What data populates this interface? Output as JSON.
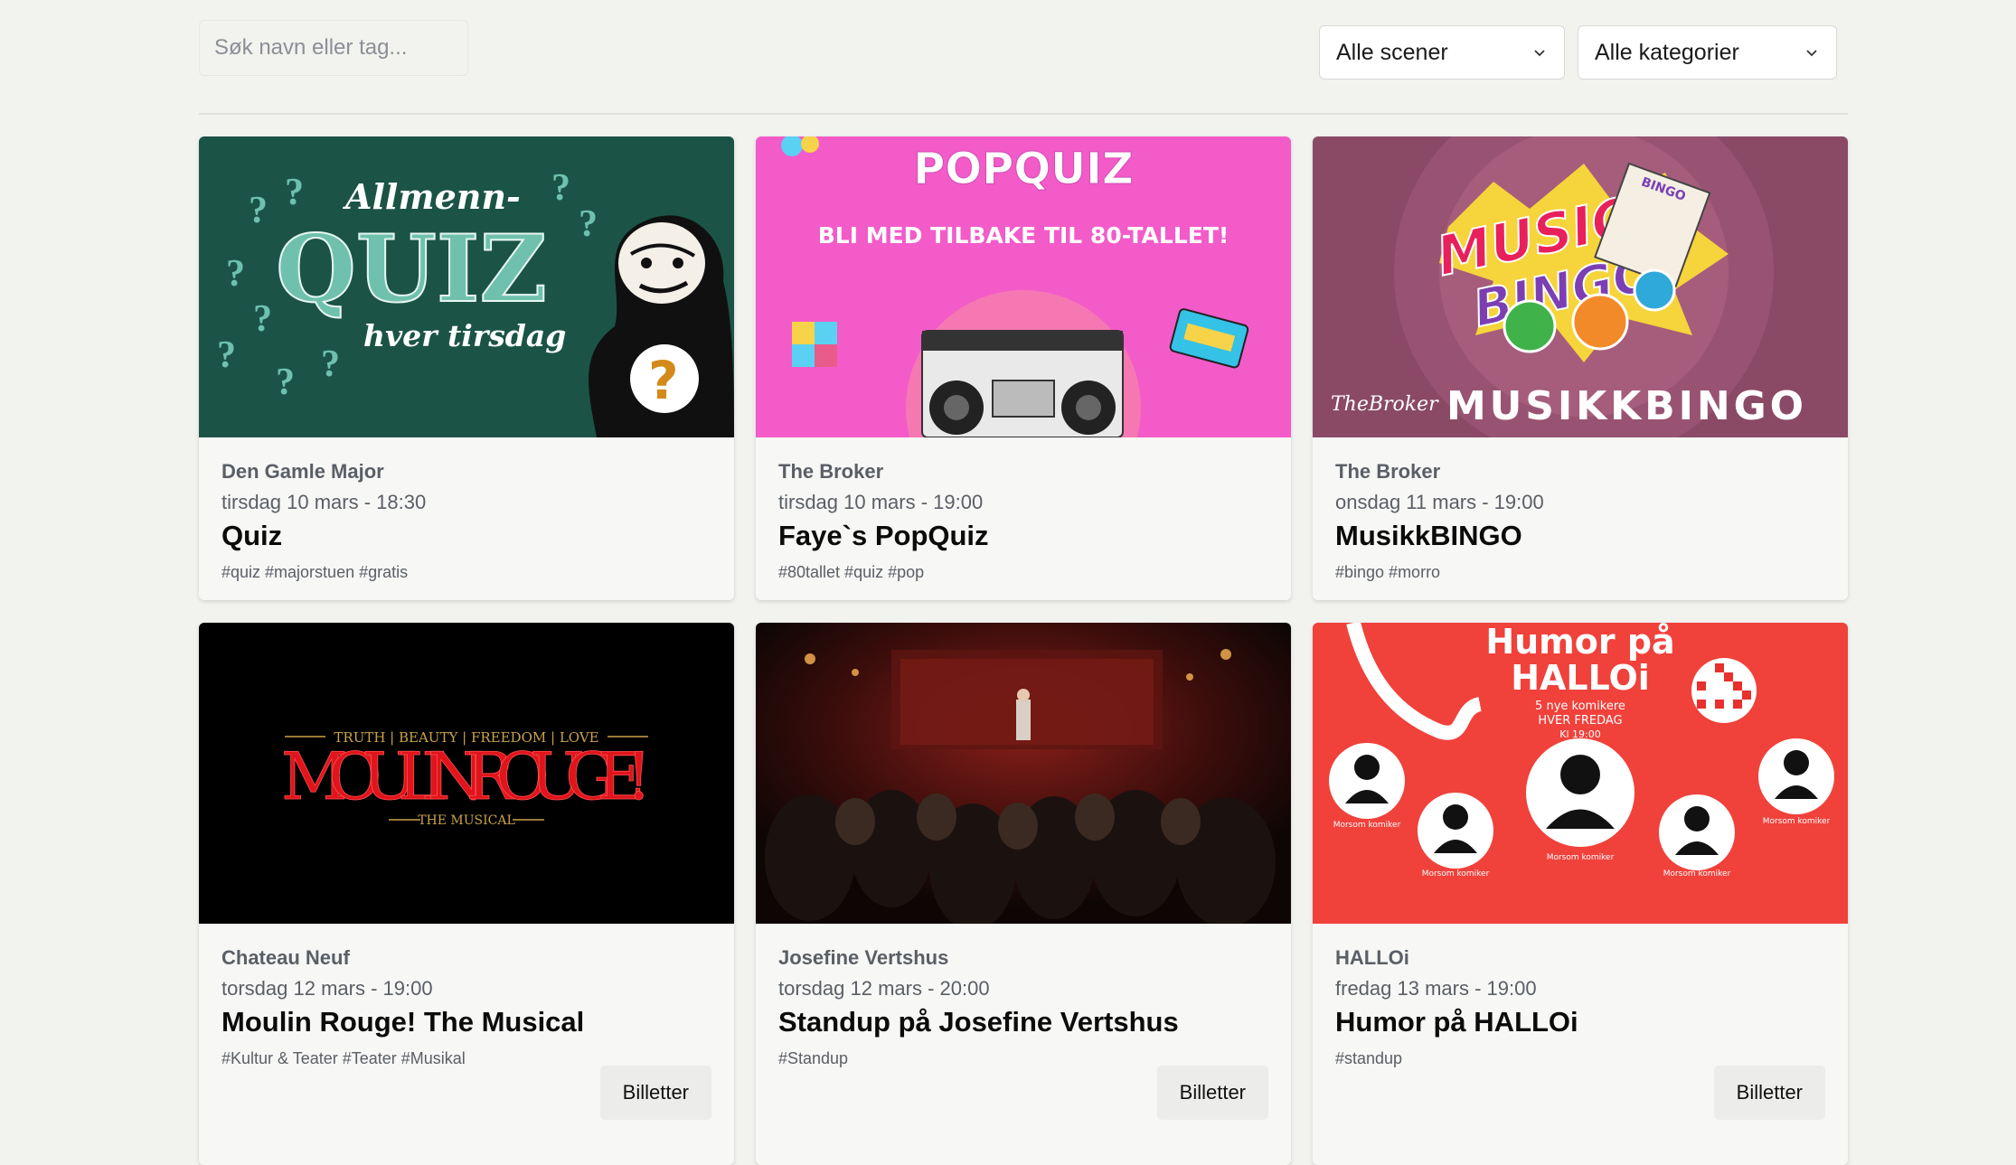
{
  "filters": {
    "search_placeholder": "Søk navn eller tag...",
    "scene_select": "Alle scener",
    "category_select": "Alle kategorier"
  },
  "events": [
    {
      "venue": "Den Gamle Major",
      "date": "tirsdag 10 mars - 18:30",
      "title": "Quiz",
      "tags": "#quiz #majorstuen #gratis",
      "image": {
        "line1": "Allmenn-",
        "line2": "QUIZ",
        "line3": "hver tirsdag",
        "bg": "#1f5c4e"
      }
    },
    {
      "venue": "The Broker",
      "date": "tirsdag 10 mars - 19:00",
      "title": "Faye`s PopQuiz",
      "tags": "#80tallet #quiz #pop",
      "image": {
        "line1": "POPQUIZ",
        "line2": "BLI MED TILBAKE TIL 80-TALLET!",
        "bg": "#f35bc9"
      }
    },
    {
      "venue": "The Broker",
      "date": "onsdag 11 mars - 19:00",
      "title": "MusikkBINGO",
      "tags": "#bingo #morro",
      "image": {
        "line1": "MUSIC",
        "line2": "BINGO!",
        "line3": "MUSIKKBINGO",
        "brand": "TheBroker",
        "badge": "BINGO",
        "bg": "#8a4a66"
      }
    },
    {
      "venue": "Chateau Neuf",
      "date": "torsdag 12 mars - 19:00",
      "title": "Moulin Rouge! The Musical",
      "tags": "#Kultur & Teater #Teater #Musikal",
      "tickets": "Billetter",
      "image": {
        "line1": "TRUTH | BEAUTY | FREEDOM | LOVE",
        "line2": "MOULIN ROUGE!",
        "line3": "THE MUSICAL",
        "bg": "#000000"
      }
    },
    {
      "venue": "Josefine Vertshus",
      "date": "torsdag 12 mars - 20:00",
      "title": "Standup på Josefine Vertshus",
      "tags": "#Standup",
      "tickets": "Billetter",
      "image": {
        "bg": "#1a0f0c"
      }
    },
    {
      "venue": "HALLOi",
      "date": "fredag 13 mars - 19:00",
      "title": "Humor på HALLOi",
      "tags": "#standup",
      "tickets": "Billetter",
      "image": {
        "line1": "Humor på",
        "line2": "HALLOi",
        "line3": "5 nye komikere",
        "line4": "HVER FREDAG",
        "line5": "Kl 19:00",
        "person": "Morsom komiker",
        "bg": "#f0413b"
      }
    }
  ],
  "colors": {
    "page_bg": "#f2f2ef",
    "card_bg": "#f7f7f5",
    "muted_text": "#5a5f66"
  }
}
